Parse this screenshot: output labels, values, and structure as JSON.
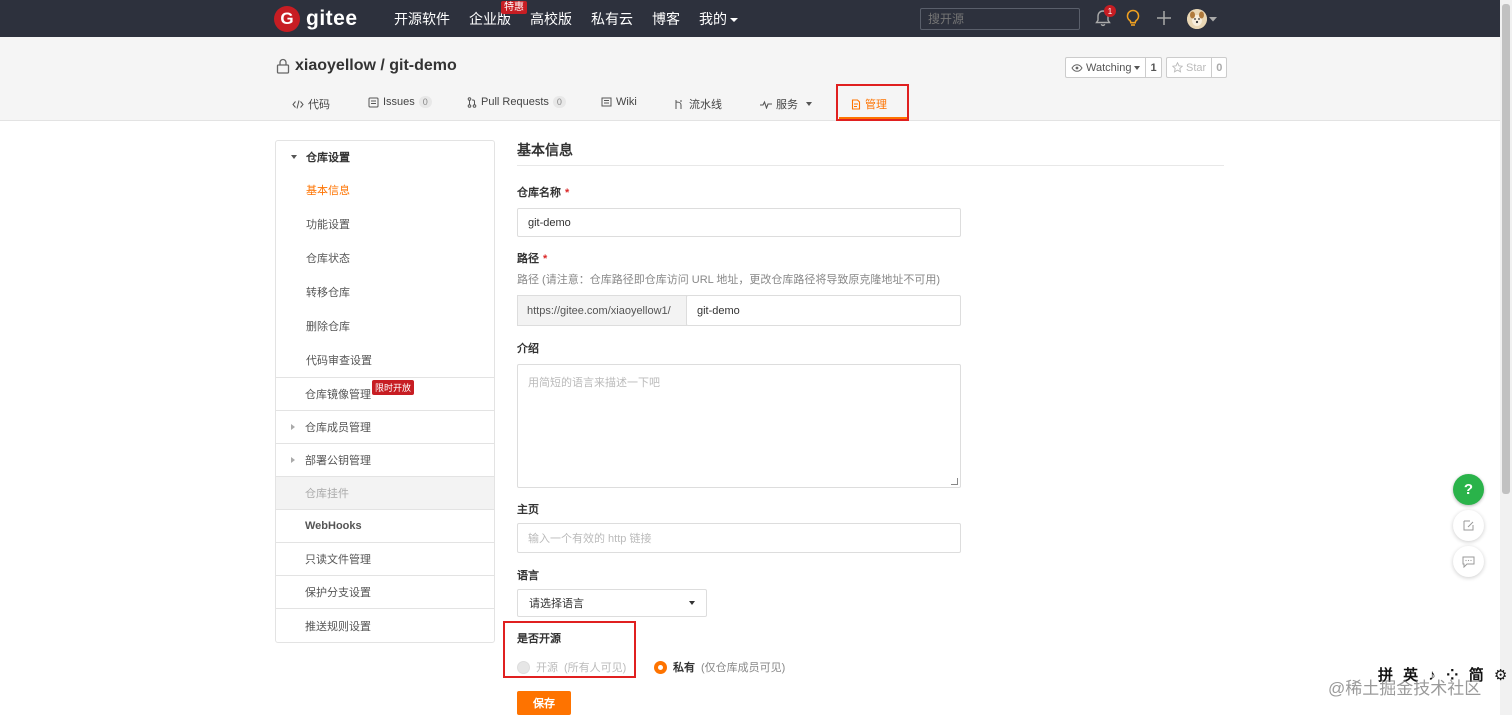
{
  "topnav": {
    "logo_letter": "G",
    "logo_text": "gitee",
    "links": [
      "开源软件",
      "企业版",
      "高校版",
      "私有云",
      "博客",
      "我的"
    ],
    "hot_badge": "特惠",
    "search_placeholder": "搜开源",
    "notif_count": "1"
  },
  "repo": {
    "title": "xiaoyellow / git-demo",
    "watch_label": "Watching",
    "watch_count": "1",
    "star_label": "Star",
    "star_count": "0"
  },
  "tabs": [
    {
      "label": "代码"
    },
    {
      "label": "Issues",
      "count": "0"
    },
    {
      "label": "Pull Requests",
      "count": "0"
    },
    {
      "label": "Wiki"
    },
    {
      "label": "流水线"
    },
    {
      "label": "服务"
    },
    {
      "label": "管理"
    }
  ],
  "sidebar": {
    "group_title": "仓库设置",
    "sub_items": [
      "基本信息",
      "功能设置",
      "仓库状态",
      "转移仓库",
      "删除仓库",
      "代码审查设置"
    ],
    "items": [
      {
        "label": "仓库镜像管理",
        "badge": "限时开放"
      },
      {
        "label": "仓库成员管理"
      },
      {
        "label": "部署公钥管理"
      },
      {
        "label": "仓库挂件"
      },
      {
        "label": "WebHooks"
      },
      {
        "label": "只读文件管理"
      },
      {
        "label": "保护分支设置"
      },
      {
        "label": "推送规则设置"
      }
    ]
  },
  "form": {
    "section_title": "基本信息",
    "name_label": "仓库名称",
    "name_value": "git-demo",
    "path_label": "路径",
    "path_hint": "路径 (请注意：仓库路径即仓库访问 URL 地址，更改仓库路径将导致原克隆地址不可用)",
    "path_prefix": "https://gitee.com/xiaoyellow1/",
    "path_value": "git-demo",
    "desc_label": "介绍",
    "desc_placeholder": "用简短的语言来描述一下吧",
    "homepage_label": "主页",
    "homepage_placeholder": "输入一个有效的 http 链接",
    "lang_label": "语言",
    "lang_value": "请选择语言",
    "open_label": "是否开源",
    "opt_public": "开源",
    "opt_public_note": "(所有人可见)",
    "opt_private": "私有",
    "opt_private_note": "(仅仓库成员可见)",
    "save_label": "保存"
  },
  "floating": {
    "help": "?"
  },
  "ime": "拼 英 ♪ ⁘ 简 ⚙ ∷",
  "watermark": "@稀土掘金技术社区",
  "colors": {
    "accent": "#fe7300",
    "nav_bg": "#2d313d",
    "brand_red": "#c71d23",
    "highlight_box": "#e02020",
    "help_green": "#2ab34a"
  }
}
